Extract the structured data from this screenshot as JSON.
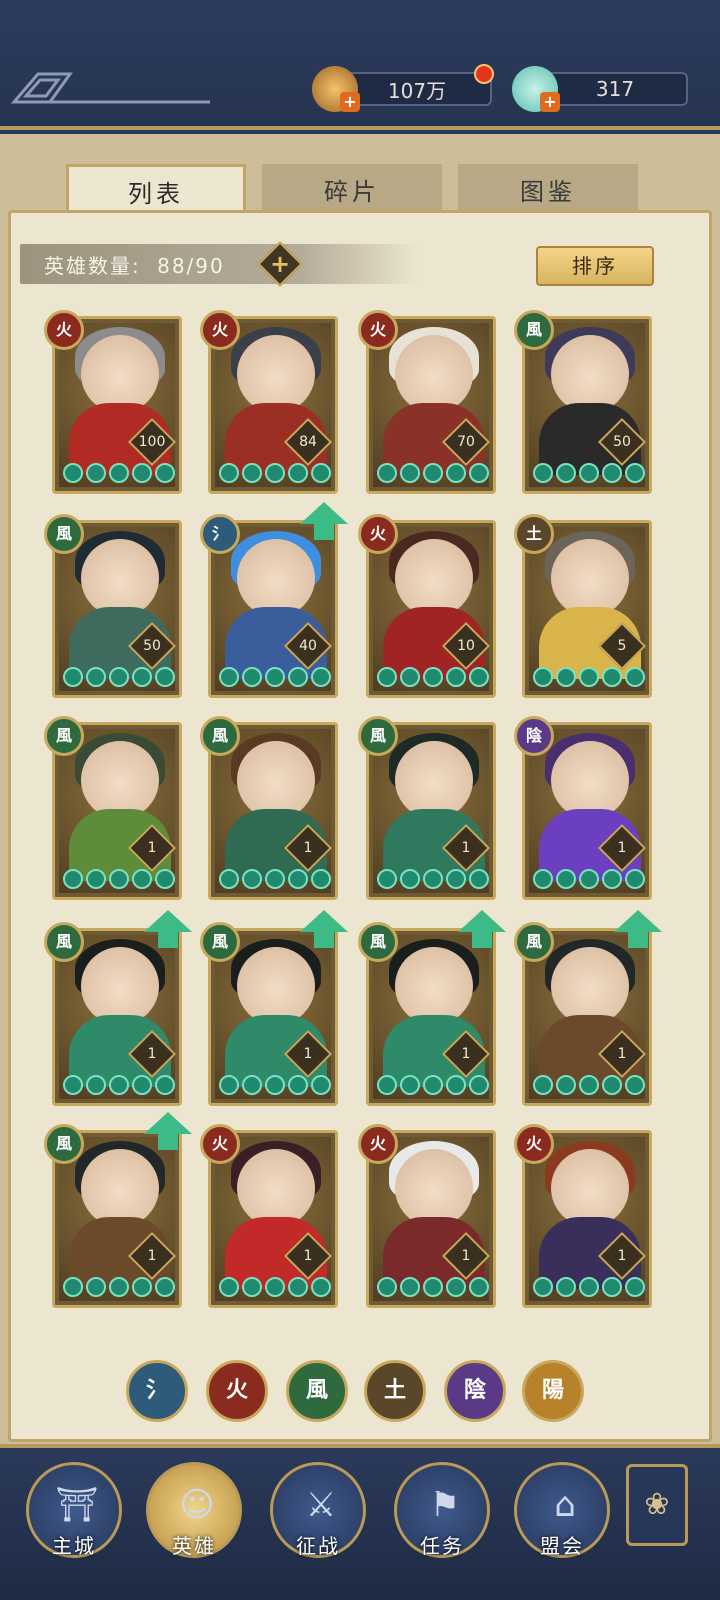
{
  "currencies": [
    {
      "name": "coins",
      "value": "107万",
      "color": "#d8a24b",
      "has_red_dot": true
    },
    {
      "name": "shells",
      "value": "317",
      "color": "#7fd6c5",
      "has_red_dot": false
    }
  ],
  "tabs": [
    {
      "label": "列表",
      "active": true
    },
    {
      "label": "碎片",
      "active": false
    },
    {
      "label": "图鉴",
      "active": false
    }
  ],
  "hero_count": {
    "label": "英雄数量:",
    "value": "88/90"
  },
  "sort_label": "排序",
  "element_glyphs": {
    "water": "氵",
    "fire": "火",
    "wind": "風",
    "earth": "土",
    "yin": "陰",
    "yang": "陽"
  },
  "element_colors": {
    "water": "#2d5b79",
    "fire": "#8b2a1f",
    "wind": "#2f6a3f",
    "earth": "#5a4628",
    "yin": "#5a3a86",
    "yang": "#b7822a"
  },
  "heroes": [
    {
      "element": "fire",
      "glyph": "火",
      "level": "100",
      "stars": 5,
      "upgrade": false,
      "hair": "#8c8c8c",
      "outfit": "#b22a24"
    },
    {
      "element": "fire",
      "glyph": "火",
      "level": "84",
      "stars": 5,
      "upgrade": false,
      "hair": "#3a3f4a",
      "outfit": "#9c2f24"
    },
    {
      "element": "fire",
      "glyph": "火",
      "level": "70",
      "stars": 5,
      "upgrade": false,
      "hair": "#e8e2d6",
      "outfit": "#8a3228"
    },
    {
      "element": "wind",
      "glyph": "風",
      "level": "50",
      "stars": 5,
      "upgrade": false,
      "hair": "#3d3a5a",
      "outfit": "#2a2a2a"
    },
    {
      "element": "wind",
      "glyph": "風",
      "level": "50",
      "stars": 5,
      "upgrade": false,
      "hair": "#1f2b35",
      "outfit": "#3f6b5f"
    },
    {
      "element": "water",
      "glyph": "氵",
      "level": "40",
      "stars": 5,
      "upgrade": true,
      "hair": "#3f8fe0",
      "outfit": "#3a5e9c"
    },
    {
      "element": "fire",
      "glyph": "火",
      "level": "10",
      "stars": 5,
      "upgrade": false,
      "hair": "#4a2a20",
      "outfit": "#a02424"
    },
    {
      "element": "earth",
      "glyph": "土",
      "level": "5",
      "stars": 5,
      "upgrade": false,
      "hair": "#6b6458",
      "outfit": "#d8b44a"
    },
    {
      "element": "wind",
      "glyph": "風",
      "level": "1",
      "stars": 5,
      "upgrade": false,
      "hair": "#3b4a34",
      "outfit": "#5e8c3a"
    },
    {
      "element": "wind",
      "glyph": "風",
      "level": "1",
      "stars": 5,
      "upgrade": false,
      "hair": "#5a3a22",
      "outfit": "#2f6a52"
    },
    {
      "element": "wind",
      "glyph": "風",
      "level": "1",
      "stars": 5,
      "upgrade": false,
      "hair": "#1e2a26",
      "outfit": "#2f7a5f"
    },
    {
      "element": "yin",
      "glyph": "陰",
      "level": "1",
      "stars": 5,
      "upgrade": false,
      "hair": "#4a2f6e",
      "outfit": "#6a3fc0"
    },
    {
      "element": "wind",
      "glyph": "風",
      "level": "1",
      "stars": 5,
      "upgrade": true,
      "hair": "#1a1f1e",
      "outfit": "#2f8a6a"
    },
    {
      "element": "wind",
      "glyph": "風",
      "level": "1",
      "stars": 5,
      "upgrade": true,
      "hair": "#1a1f1e",
      "outfit": "#2f8a6a"
    },
    {
      "element": "wind",
      "glyph": "風",
      "level": "1",
      "stars": 5,
      "upgrade": true,
      "hair": "#1a1f1e",
      "outfit": "#2f8a6a"
    },
    {
      "element": "wind",
      "glyph": "風",
      "level": "1",
      "stars": 5,
      "upgrade": true,
      "hair": "#222829",
      "outfit": "#6a4a2a"
    },
    {
      "element": "wind",
      "glyph": "風",
      "level": "1",
      "stars": 5,
      "upgrade": true,
      "hair": "#222829",
      "outfit": "#6a4a2a"
    },
    {
      "element": "fire",
      "glyph": "火",
      "level": "1",
      "stars": 5,
      "upgrade": false,
      "hair": "#3a1f24",
      "outfit": "#c22a2a"
    },
    {
      "element": "fire",
      "glyph": "火",
      "level": "1",
      "stars": 5,
      "upgrade": false,
      "hair": "#e8e8e8",
      "outfit": "#7a2a2a"
    },
    {
      "element": "fire",
      "glyph": "火",
      "level": "1",
      "stars": 5,
      "upgrade": false,
      "hair": "#8a3a1f",
      "outfit": "#3a2f5a"
    }
  ],
  "filters": [
    {
      "glyph": "氵",
      "element": "water"
    },
    {
      "glyph": "火",
      "element": "fire"
    },
    {
      "glyph": "風",
      "element": "wind"
    },
    {
      "glyph": "土",
      "element": "earth"
    },
    {
      "glyph": "陰",
      "element": "yin"
    },
    {
      "glyph": "陽",
      "element": "yang"
    }
  ],
  "nav": [
    {
      "label": "主城",
      "icon": "city-gate-icon",
      "active": false
    },
    {
      "label": "英雄",
      "icon": "hero-icon",
      "active": true
    },
    {
      "label": "征战",
      "icon": "battle-icon",
      "active": false
    },
    {
      "label": "任务",
      "icon": "task-icon",
      "active": false
    },
    {
      "label": "盟会",
      "icon": "guild-icon",
      "active": false
    }
  ],
  "more_icon": "menu-flower-icon"
}
